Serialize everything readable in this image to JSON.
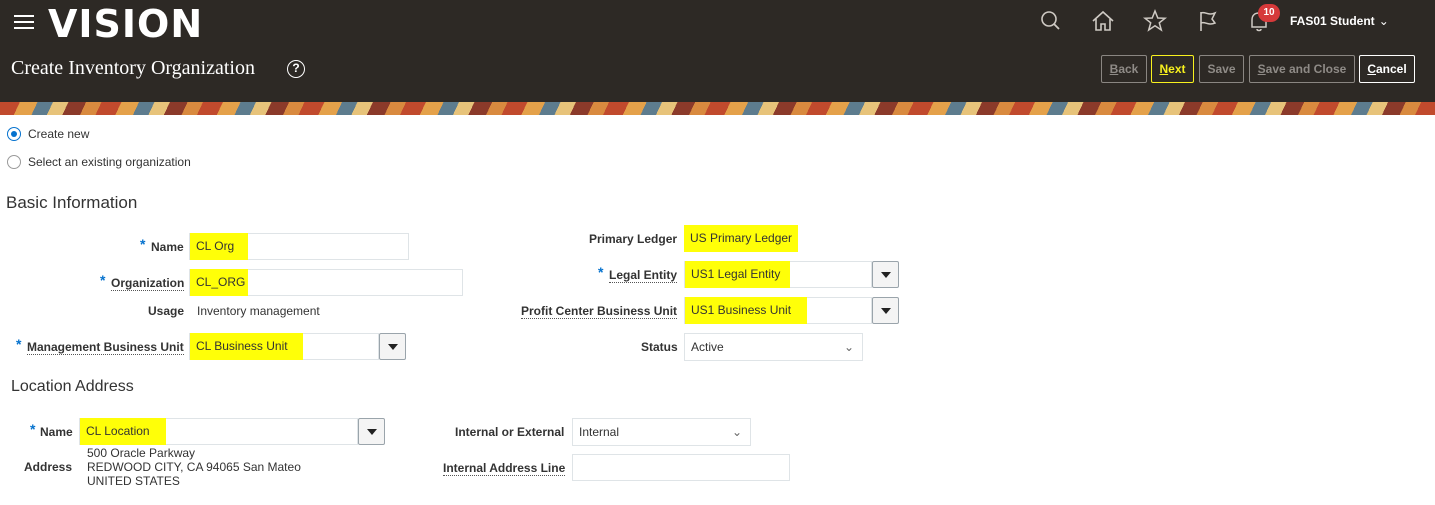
{
  "header": {
    "logo": "VISION",
    "notification_count": "10",
    "user": "FAS01 Student",
    "icons": [
      "search-icon",
      "home-icon",
      "star-icon",
      "flag-icon",
      "bell-icon"
    ]
  },
  "page": {
    "title": "Create Inventory Organization",
    "buttons": {
      "back": "Back",
      "next": "Next",
      "save": "Save",
      "save_close": "Save and Close",
      "cancel": "Cancel"
    }
  },
  "mode": {
    "create_new": "Create new",
    "select_existing": "Select an existing organization",
    "selected": "create_new"
  },
  "basic": {
    "heading": "Basic Information",
    "name_label": "Name",
    "name_value": "CL Org",
    "org_label": "Organization",
    "org_value": "CL_ORG",
    "usage_label": "Usage",
    "usage_value": "Inventory management",
    "mbu_label": "Management Business Unit",
    "mbu_value": "CL Business Unit",
    "ledger_label": "Primary Ledger",
    "ledger_value": "US Primary Ledger",
    "legal_label": "Legal Entity",
    "legal_value": "US1 Legal Entity",
    "pcbu_label": "Profit Center Business Unit",
    "pcbu_value": "US1 Business Unit",
    "status_label": "Status",
    "status_value": "Active"
  },
  "location": {
    "heading": "Location Address",
    "name_label": "Name",
    "name_value": "CL Location",
    "address_label": "Address",
    "address_line1": "500 Oracle Parkway",
    "address_line2": "REDWOOD CITY, CA 94065 San Mateo",
    "address_line3": "UNITED STATES",
    "internal_label": "Internal or External",
    "internal_value": "Internal",
    "ial_label": "Internal Address Line",
    "ial_value": ""
  },
  "colors": {
    "header_bg": "#2d2925",
    "highlight": "#ffff08",
    "accent": "#0572ce",
    "next_button": "#f8f11e"
  }
}
